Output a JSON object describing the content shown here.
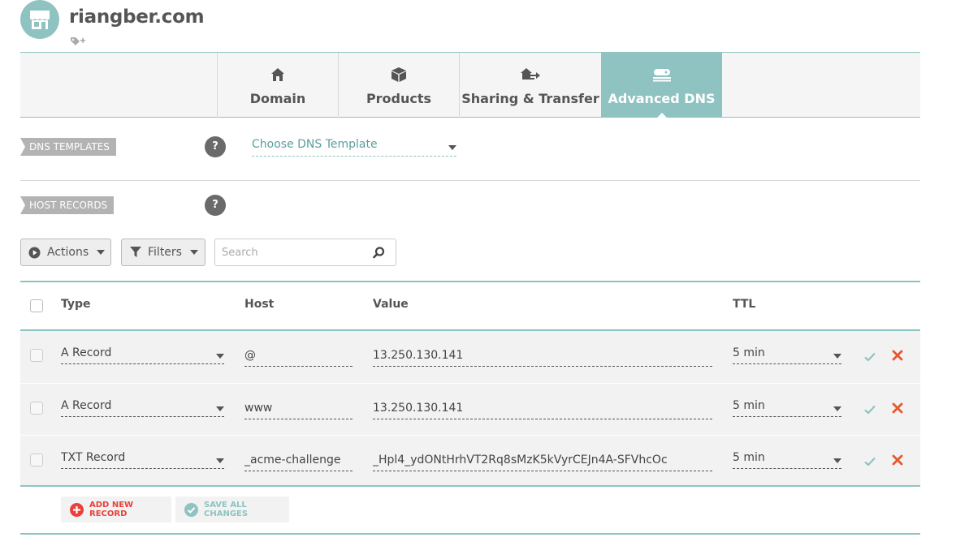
{
  "header": {
    "domain": "riangber.com",
    "logo_icon": "store-icon",
    "tag_icon": "add-tag-icon"
  },
  "tabs": [
    {
      "label": "Domain",
      "icon": "home-icon",
      "active": false
    },
    {
      "label": "Products",
      "icon": "box-icon",
      "active": false
    },
    {
      "label": "Sharing & Transfer",
      "icon": "transfer-icon",
      "active": false
    },
    {
      "label": "Advanced DNS",
      "icon": "dns-icon",
      "active": true
    }
  ],
  "dns_templates": {
    "section_label": "DNS TEMPLATES",
    "help": "?",
    "select_value": "Choose DNS Template"
  },
  "host_records": {
    "section_label": "HOST RECORDS",
    "help": "?"
  },
  "toolbar": {
    "actions_label": "Actions",
    "filters_label": "Filters",
    "search_placeholder": "Search"
  },
  "table": {
    "headers": {
      "type": "Type",
      "host": "Host",
      "value": "Value",
      "ttl": "TTL"
    },
    "rows": [
      {
        "type": "A Record",
        "host": "@",
        "value": "13.250.130.141",
        "ttl": "5 min"
      },
      {
        "type": "A Record",
        "host": "www",
        "value": "13.250.130.141",
        "ttl": "5 min"
      },
      {
        "type": "TXT Record",
        "host": "_acme-challenge",
        "value": "_Hpl4_ydONtHrhVT2Rq8sMzK5kVyrCEJn4A-SFVhcOc",
        "ttl": "5 min"
      }
    ]
  },
  "footer": {
    "add_label": "ADD NEW RECORD",
    "save_label": "SAVE ALL CHANGES"
  },
  "colors": {
    "accent": "#8fc3c1",
    "delete": "#e8582c",
    "add": "#e8413c"
  }
}
